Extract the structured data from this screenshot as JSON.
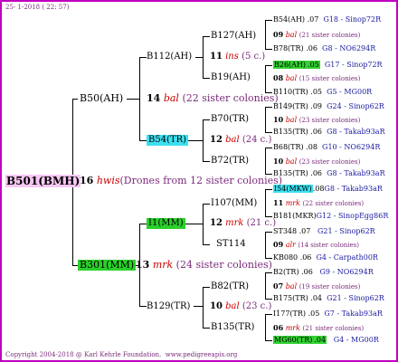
{
  "header": {
    "date": "25-  1-2018 ( 22: 57)"
  },
  "root": {
    "id": "B501(BMH)",
    "num": "16",
    "code": "hwis",
    "desc": "(Drones from 12 sister colonies)"
  },
  "gen1": {
    "top": {
      "id": "B50(AH)",
      "num": "14",
      "code": "bal",
      "desc": "(22 sister colonies)"
    },
    "bottom": {
      "id": "B301(MM)",
      "num": "13",
      "code": "mrk",
      "desc": "(24 sister colonies)"
    }
  },
  "gen2": {
    "a": {
      "id": "B112(AH)",
      "num": "11",
      "code": "ins",
      "desc": "(5 c.)"
    },
    "b": {
      "id": "B54(TR)",
      "num": "12",
      "code": "bal",
      "desc": "(24 c.)"
    },
    "c": {
      "id": "I1(MM)",
      "num": "12",
      "code": "mrk",
      "desc": "(21 c.)"
    },
    "d": {
      "id": "B129(TR)",
      "num": "10",
      "code": "bal",
      "desc": "(23 c.)"
    }
  },
  "gen3": {
    "a1": "B127(AH)",
    "a2": "B19(AH)",
    "b1": "B70(TR)",
    "b2": "B72(TR)",
    "c1": "I107(MM)",
    "c2": "ST114",
    "d1": "B82(TR)",
    "d2": "B135(TR)"
  },
  "gen4": [
    {
      "id": "B54(AH)",
      "val": ".07",
      "ref": "G18 - Sinop72R",
      "num": "09",
      "code": "bal",
      "desc": "(21 sister colonies)",
      "sub_id": "B78(TR)",
      "sub_val": ".06",
      "sub_ref": "G8 - NO6294R"
    },
    {
      "id": "B26(AH)",
      "val": ".05",
      "ref": "G17 - Sinop72R",
      "num": "08",
      "code": "bal",
      "desc": "(15 sister colonies)",
      "sub_id": "B110(TR)",
      "sub_val": ".05",
      "sub_ref": "G5 - MG00R"
    },
    {
      "id": "B149(TR)",
      "val": ".09",
      "ref": "G24 - Sinop62R",
      "num": "10",
      "code": "bal",
      "desc": "(23 sister colonies)",
      "sub_id": "B135(TR)",
      "sub_val": ".06",
      "sub_ref": "G8 - Takab93aR"
    },
    {
      "id": "B68(TR)",
      "val": ".08",
      "ref": "G10 - NO6294R",
      "num": "10",
      "code": "bal",
      "desc": "(23 sister colonies)",
      "sub_id": "B135(TR)",
      "sub_val": ".06",
      "sub_ref": "G8 - Takab93aR"
    },
    {
      "id": "I54(MKW)",
      "val": ".08",
      "ref": "G8 - Takab93aR",
      "num": "11",
      "code": "mrk",
      "desc": "(22 sister colonies)",
      "sub_id": "B181(MKR)",
      "sub_val": "",
      "sub_ref": "G12 - SinopEgg86R"
    },
    {
      "id": "ST348",
      "val": ".07",
      "ref": "G21 - Sinop62R",
      "num": "09",
      "code": "alr",
      "desc": "(14 sister colonies)",
      "sub_id": "KB080",
      "sub_val": ".06",
      "sub_ref": "G4 - Carpath00R"
    },
    {
      "id": "B2(TR)",
      "val": ".06",
      "ref": "G9 - NO6294R",
      "num": "07",
      "code": "bal",
      "desc": "(19 sister colonies)",
      "sub_id": "B175(TR)",
      "sub_val": ".04",
      "sub_ref": "G21 - Sinop62R"
    },
    {
      "id": "I177(TR)",
      "val": ".05",
      "ref": "G7 - Takab93aR",
      "num": "06",
      "code": "mrk",
      "desc": "(21 sister colonies)",
      "sub_id": "MG60(TR)",
      "sub_val": ".04",
      "sub_ref": "G4 - MG00R"
    }
  ],
  "footer": {
    "copyright": "Copyright 2004-2018 @ Karl Kehrle Foundation.",
    "url": "www.pedigreeapis.org"
  }
}
